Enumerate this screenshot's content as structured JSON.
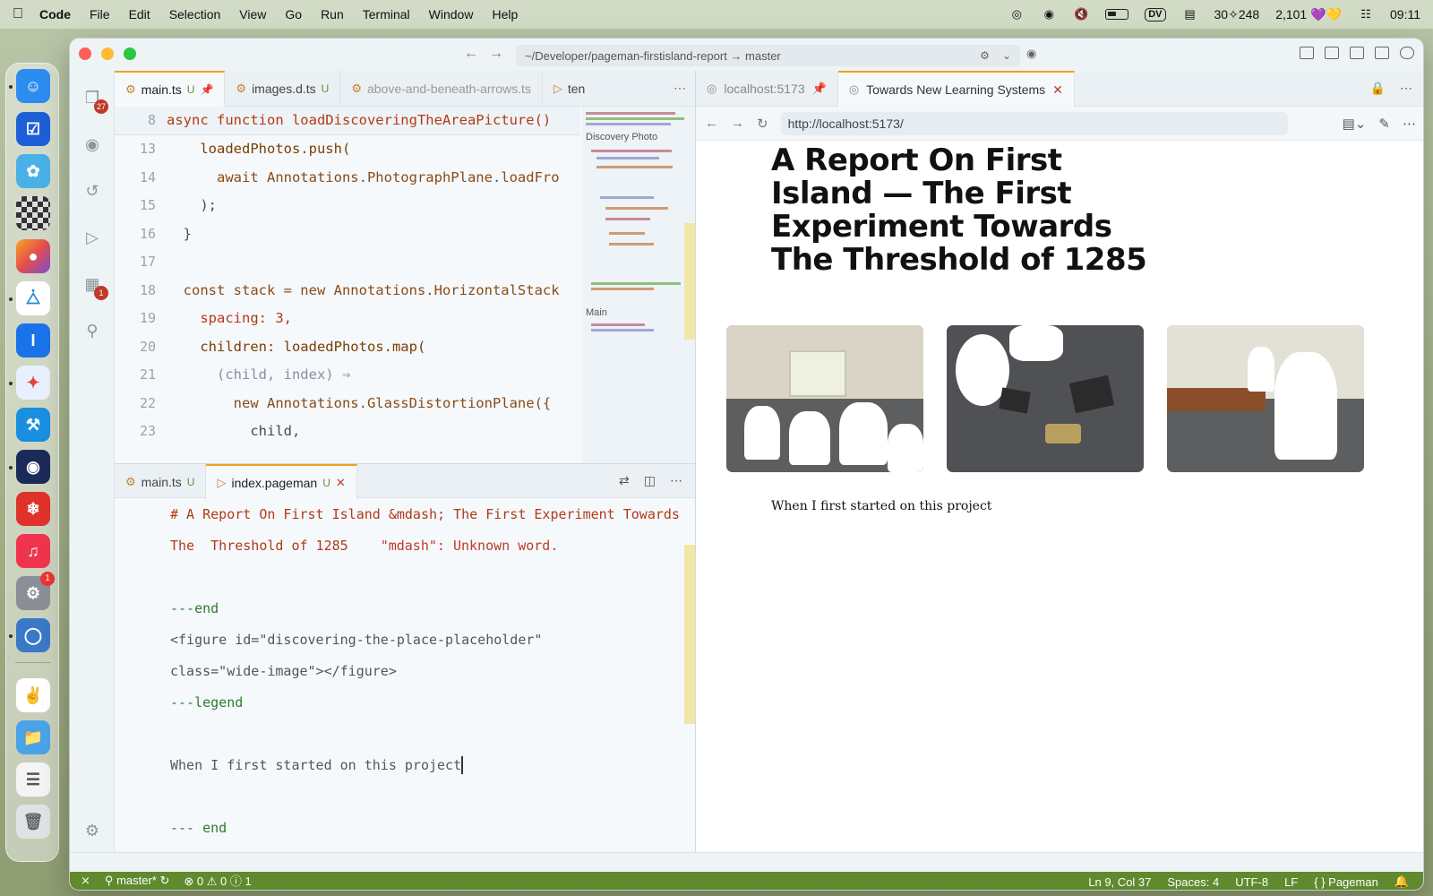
{
  "menubar": {
    "apple_icon": "apple-icon",
    "items": [
      "Code",
      "File",
      "Edit",
      "Selection",
      "View",
      "Go",
      "Run",
      "Terminal",
      "Window",
      "Help"
    ],
    "status": {
      "dv": "DV",
      "counter": "30✧248",
      "score": "2,101",
      "hearts": "💜💛",
      "clock": "09:11"
    }
  },
  "dock": {
    "items": [
      {
        "name": "finder",
        "badge": ""
      },
      {
        "name": "tasks",
        "badge": ""
      },
      {
        "name": "app-blue",
        "badge": ""
      },
      {
        "name": "checker-app",
        "badge": ""
      },
      {
        "name": "pixel-app",
        "badge": ""
      },
      {
        "name": "vscode",
        "badge": ""
      },
      {
        "name": "i-app",
        "badge": ""
      },
      {
        "name": "star-app",
        "badge": ""
      },
      {
        "name": "xcode",
        "badge": ""
      },
      {
        "name": "ghost-app",
        "badge": ""
      },
      {
        "name": "snowflake-app",
        "badge": ""
      },
      {
        "name": "music",
        "badge": ""
      },
      {
        "name": "system-settings",
        "badge": "1"
      },
      {
        "name": "disk-app",
        "badge": ""
      },
      {
        "name": "mascot-app",
        "badge": ""
      },
      {
        "name": "folder",
        "badge": ""
      },
      {
        "name": "document",
        "badge": ""
      },
      {
        "name": "trash",
        "badge": ""
      }
    ]
  },
  "window": {
    "command_center": "~/Developer/pageman-firstisland-report → master",
    "activity_badges": {
      "explorer": "27",
      "extensions": "1"
    }
  },
  "editor_top": {
    "tabs": [
      {
        "label": "main.ts",
        "status": "U",
        "active": true
      },
      {
        "label": "images.d.ts",
        "status": "U",
        "active": false
      },
      {
        "label": "above-and-beneath-arrows.ts",
        "status": "",
        "active": false
      },
      {
        "label": "ten",
        "status": "",
        "active": false
      }
    ],
    "sticky_line": {
      "num": "8",
      "text": "async function loadDiscoveringTheAreaPicture()"
    },
    "lines": [
      {
        "num": "13",
        "text": "    loadedPhotos.push("
      },
      {
        "num": "14",
        "text": "      await Annotations.PhotographPlane.loadFro"
      },
      {
        "num": "15",
        "text": "    );"
      },
      {
        "num": "16",
        "text": "  }"
      },
      {
        "num": "17",
        "text": ""
      },
      {
        "num": "18",
        "text": "  const stack = new Annotations.HorizontalStack"
      },
      {
        "num": "19",
        "text": "    spacing: 3,"
      },
      {
        "num": "20",
        "text": "    children: loadedPhotos.map("
      },
      {
        "num": "21",
        "text": "      (child, index) ⇒"
      },
      {
        "num": "22",
        "text": "        new Annotations.GlassDistortionPlane({"
      },
      {
        "num": "23",
        "text": "          child,"
      }
    ],
    "minimap_labels": [
      "Discovery Photo",
      "Main"
    ]
  },
  "editor_bottom": {
    "tabs": [
      {
        "label": "main.ts",
        "status": "U",
        "active": false
      },
      {
        "label": "index.pageman",
        "status": "U",
        "active": true
      }
    ],
    "lines": [
      {
        "text": "# A Report On First Island &mdash; The First Experiment Towards",
        "kind": "heading"
      },
      {
        "text": "The  Threshold of 1285",
        "kind": "heading",
        "diag": "\"mdash\": Unknown word."
      },
      {
        "text": "",
        "kind": "blank"
      },
      {
        "text": "---end",
        "kind": "meta"
      },
      {
        "text": "<figure id=\"discovering-the-place-placeholder\"",
        "kind": "tag"
      },
      {
        "text": "class=\"wide-image\"></figure>",
        "kind": "tag"
      },
      {
        "text": "---legend",
        "kind": "meta"
      },
      {
        "text": "",
        "kind": "blank"
      },
      {
        "text": "When I first started on this project",
        "kind": "text"
      },
      {
        "text": "",
        "kind": "blank"
      },
      {
        "text": "--- end",
        "kind": "meta"
      }
    ]
  },
  "browser": {
    "tabs": [
      {
        "label": "localhost:5173",
        "active": false
      },
      {
        "label": "Towards New Learning Systems",
        "active": true
      }
    ],
    "url": "http://localhost:5173/",
    "page": {
      "title": "A Report On First Island — The First Experiment Towards The Threshold of 1285",
      "caption": "When I first started on this project"
    }
  },
  "statusbar": {
    "branch": "master*",
    "errors": "0",
    "warnings": "0",
    "info": "1",
    "position": "Ln 9, Col 37",
    "spaces": "Spaces: 4",
    "encoding": "UTF-8",
    "eol": "LF",
    "language": "Pageman"
  }
}
